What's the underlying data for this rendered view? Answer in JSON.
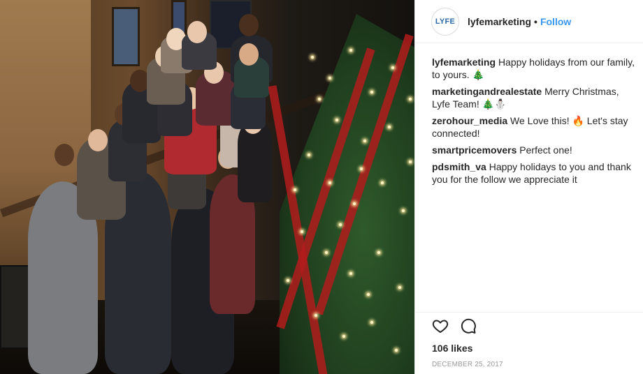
{
  "post": {
    "username": "lyfemarketing",
    "avatar_text": "LYFE",
    "dot": "•",
    "follow_label": "Follow",
    "likes": "106 likes",
    "date": "DECEMBER 25, 2017"
  },
  "comments": [
    {
      "user": "lyfemarketing",
      "text": "Happy holidays from our family, to yours. 🎄"
    },
    {
      "user": "marketingandrealestate",
      "text": "Merry Christmas, Lyfe Team! 🎄⛄"
    },
    {
      "user": "zerohour_media",
      "text": "We Love this! 🔥 Let's stay connected!"
    },
    {
      "user": "smartpricemovers",
      "text": "Perfect one!"
    },
    {
      "user": "pdsmith_va",
      "text": "Happy holidays to you and thank you for the follow we appreciate it"
    }
  ],
  "icons": {
    "like": "heart-icon",
    "comment": "comment-icon"
  },
  "photo": {
    "description_icon": "group-photo"
  },
  "colors": {
    "accent": "#3897f0",
    "text": "#262626",
    "muted": "#999999",
    "border": "#efefef"
  }
}
